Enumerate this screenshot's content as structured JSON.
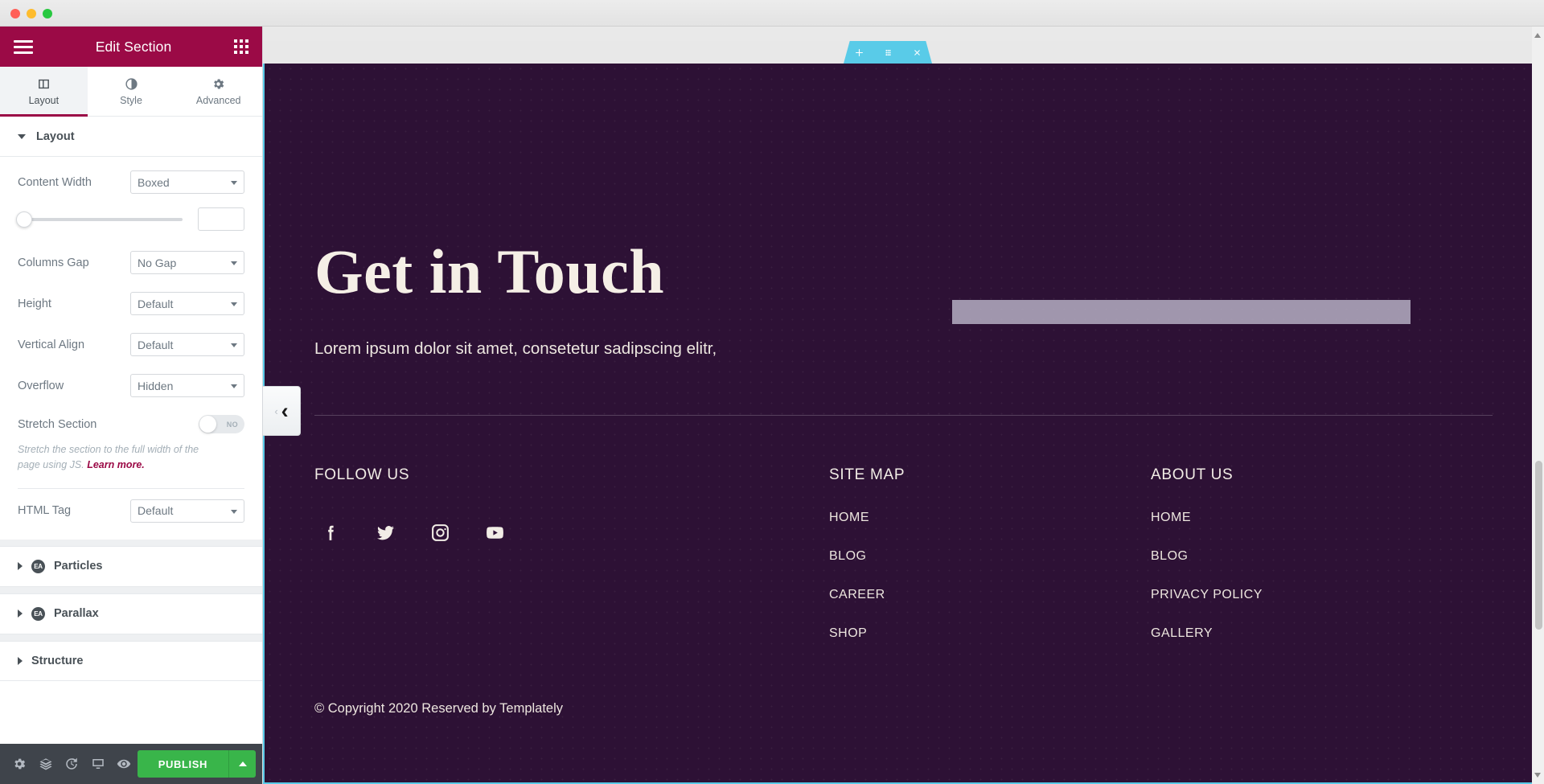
{
  "window": {
    "traffic_lights": [
      "close",
      "minimize",
      "maximize"
    ]
  },
  "panel": {
    "title": "Edit Section",
    "menu_icon": "hamburger-menu-icon",
    "apps_icon": "widgets-grid-icon",
    "tabs": [
      {
        "label": "Layout",
        "icon": "layout-columns-icon",
        "active": true
      },
      {
        "label": "Style",
        "icon": "contrast-circle-icon",
        "active": false
      },
      {
        "label": "Advanced",
        "icon": "gear-icon",
        "active": false
      }
    ],
    "layout_section": {
      "title": "Layout",
      "expanded": true,
      "controls": [
        {
          "label": "Content Width",
          "value": "Boxed",
          "type": "select"
        },
        {
          "label": "Columns Gap",
          "value": "No Gap",
          "type": "select"
        },
        {
          "label": "Height",
          "value": "Default",
          "type": "select"
        },
        {
          "label": "Vertical Align",
          "value": "Default",
          "type": "select"
        },
        {
          "label": "Overflow",
          "value": "Hidden",
          "type": "select"
        }
      ],
      "width_slider": {
        "value": "",
        "percent": 0
      },
      "stretch": {
        "label": "Stretch Section",
        "state": "NO",
        "description_1": "Stretch the section to the full width of the",
        "description_2": "page using JS.",
        "link": "Learn more."
      },
      "html_tag": {
        "label": "HTML Tag",
        "value": "Default"
      }
    },
    "accordions": [
      {
        "label": "Particles",
        "badge": "EA",
        "expanded": false
      },
      {
        "label": "Parallax",
        "badge": "EA",
        "expanded": false
      },
      {
        "label": "Structure",
        "badge": "",
        "expanded": false
      }
    ],
    "footer": {
      "icons": [
        {
          "name": "settings-gear-icon"
        },
        {
          "name": "navigator-layers-icon"
        },
        {
          "name": "history-clock-icon"
        },
        {
          "name": "responsive-monitor-icon"
        },
        {
          "name": "preview-eye-icon"
        }
      ],
      "publish_label": "PUBLISH",
      "publish_color": "#39B54A"
    },
    "accent_color": "#9B0A46"
  },
  "canvas": {
    "section_handle": {
      "add_icon": "plus-icon",
      "drag_icon": "drag-grid-icon",
      "close_icon": "close-x-icon",
      "color": "#59CBE8"
    },
    "collapse_arrow": {
      "small": "‹",
      "big": "‹"
    },
    "page": {
      "background_color": "#2D1135",
      "hero": {
        "title": "Get in Touch",
        "subtitle": "Lorem ipsum dolor sit amet, consetetur sadipscing elitr,",
        "placeholder_bar_color": "#b5aec2"
      },
      "footer": {
        "columns": [
          {
            "heading": "FOLLOW US",
            "type": "social",
            "socials": [
              {
                "name": "facebook-icon"
              },
              {
                "name": "twitter-icon"
              },
              {
                "name": "instagram-icon"
              },
              {
                "name": "youtube-icon"
              }
            ]
          },
          {
            "heading": "SITE MAP",
            "type": "links",
            "links": [
              "HOME",
              "BLOG",
              "CAREER",
              "SHOP"
            ]
          },
          {
            "heading": "ABOUT US",
            "type": "links",
            "links": [
              "HOME",
              "BLOG",
              "PRIVACY POLICY",
              "GALLERY"
            ]
          }
        ]
      },
      "copyright": "© Copyright 2020 Reserved by Templately"
    }
  }
}
